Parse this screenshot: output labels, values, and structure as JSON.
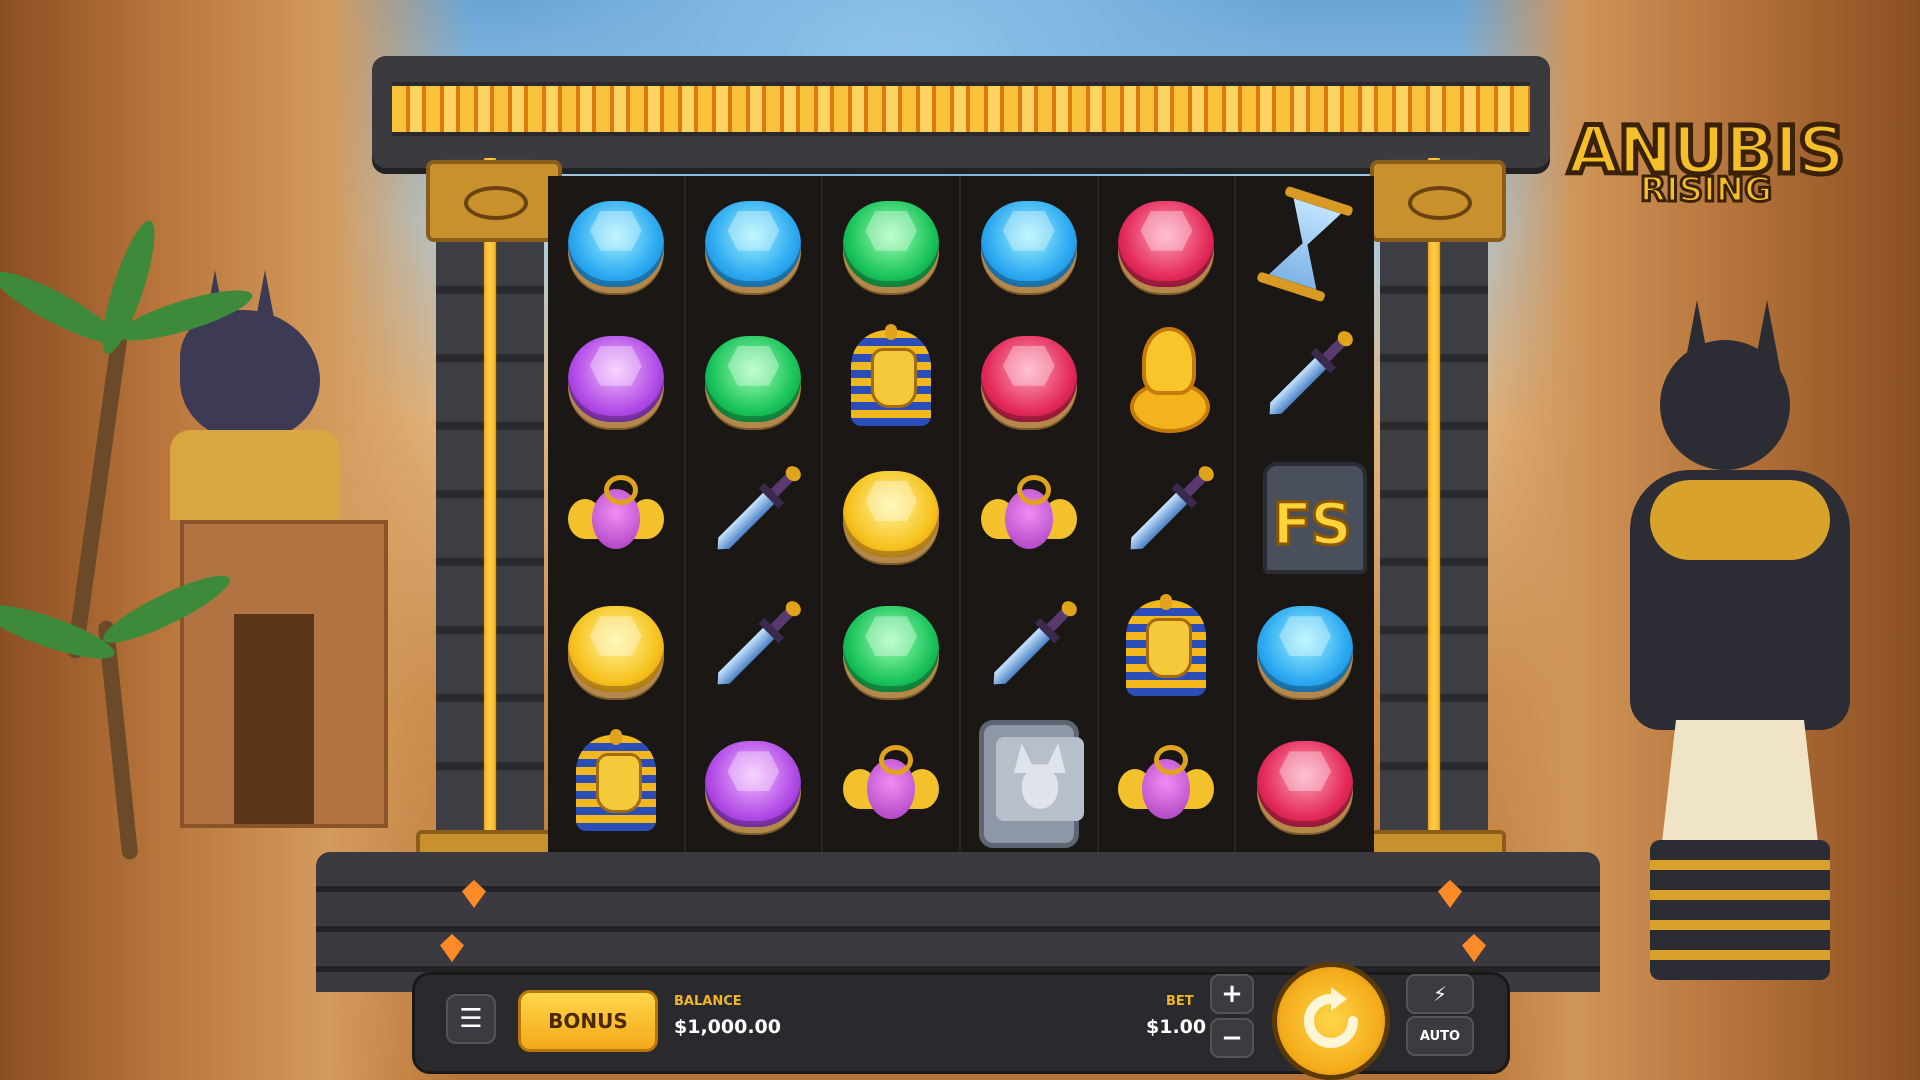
{
  "game": {
    "logo_line1": "ANUBIS",
    "logo_line2": "RISING"
  },
  "reels": [
    [
      "gem-blue",
      "gem-purple",
      "scarab",
      "gem-yellow",
      "pharaoh"
    ],
    [
      "gem-blue",
      "gem-green",
      "dagger",
      "dagger",
      "gem-purple"
    ],
    [
      "gem-green",
      "pharaoh",
      "gem-yellow",
      "gem-green",
      "scarab"
    ],
    [
      "gem-blue",
      "gem-red",
      "scarab",
      "dagger",
      "wolf-tablet"
    ],
    [
      "gem-red",
      "cobra",
      "dagger",
      "pharaoh",
      "scarab"
    ],
    [
      "hourglass",
      "dagger",
      "free-spins",
      "gem-blue",
      "gem-red"
    ]
  ],
  "symbols": {
    "free_spins_text": "FS"
  },
  "controls": {
    "menu_icon": "☰",
    "bonus_label": "BONUS",
    "balance_label": "BALANCE",
    "balance_value": "$1,000.00",
    "bet_label": "BET",
    "bet_value": "$1.00",
    "plus_icon": "+",
    "minus_icon": "−",
    "turbo_icon": "⚡",
    "auto_label": "AUTO"
  },
  "colors": {
    "accent": "#f4ac1a",
    "bar": "#2a2a2e"
  }
}
